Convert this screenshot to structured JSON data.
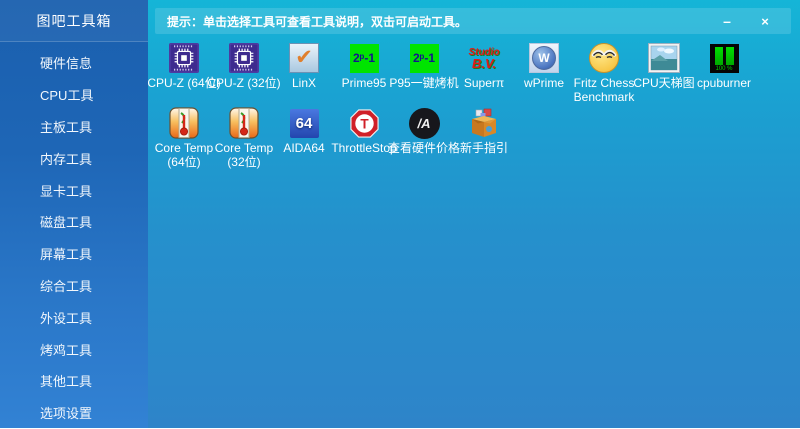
{
  "sidebar": {
    "title": "图吧工具箱",
    "items": [
      {
        "label": "硬件信息"
      },
      {
        "label": "CPU工具"
      },
      {
        "label": "主板工具"
      },
      {
        "label": "内存工具"
      },
      {
        "label": "显卡工具"
      },
      {
        "label": "磁盘工具"
      },
      {
        "label": "屏幕工具"
      },
      {
        "label": "综合工具"
      },
      {
        "label": "外设工具"
      },
      {
        "label": "烤鸡工具"
      },
      {
        "label": "其他工具"
      },
      {
        "label": "选项设置"
      }
    ]
  },
  "header": {
    "tip": "提示：单击选择工具可查看工具说明，双击可启动工具。",
    "minimize_glyph": "–",
    "close_glyph": "×"
  },
  "tools": {
    "row1": [
      {
        "name": "cpuz-64",
        "label": [
          "CPU-Z (64位)"
        ]
      },
      {
        "name": "cpuz-32",
        "label": [
          "CPU-Z (32位)"
        ]
      },
      {
        "name": "linx",
        "label": [
          "LinX"
        ],
        "icon_text": "✔"
      },
      {
        "name": "prime95",
        "label": [
          "Prime95"
        ],
        "icon_text": "2ᵖ-1"
      },
      {
        "name": "p95-bake",
        "label": [
          "P95一键烤机"
        ],
        "icon_text": "2ᵖ-1"
      },
      {
        "name": "superpi",
        "label": [
          "Superπ"
        ],
        "icon_line1": "Studio",
        "icon_line2": "B.V."
      },
      {
        "name": "wprime",
        "label": [
          "wPrime"
        ],
        "icon_text": "W"
      },
      {
        "name": "fritz-chess",
        "label": [
          "Fritz Chess",
          "Benchmark"
        ]
      },
      {
        "name": "cpu-ladder",
        "label": [
          "CPU天梯图"
        ]
      },
      {
        "name": "cpuburner",
        "label": [
          "cpuburner"
        ],
        "icon_text": "100 %"
      }
    ],
    "row2": [
      {
        "name": "coretemp-64",
        "label": [
          "Core Temp",
          "(64位)"
        ]
      },
      {
        "name": "coretemp-32",
        "label": [
          "Core Temp",
          "(32位)"
        ]
      },
      {
        "name": "aida64",
        "label": [
          "AIDA64"
        ],
        "icon_text": "64"
      },
      {
        "name": "throttlestop",
        "label": [
          "ThrottleStop"
        ],
        "icon_text": "T"
      },
      {
        "name": "hw-price",
        "label": [
          "查看硬件价格"
        ],
        "icon_text": "/A"
      },
      {
        "name": "newbie-guide",
        "label": [
          "新手指引"
        ]
      }
    ]
  },
  "colors": {
    "sidebar_top": "#1a5fae",
    "sidebar_bottom": "#3282d4",
    "content_top": "#15b5d7",
    "content_bottom": "#2e84c9",
    "prime_green": "#00e400",
    "cpuz_purple": "#3e2b8f",
    "throttlestop_red": "#d02028",
    "aida_blue": "#2346ae"
  }
}
